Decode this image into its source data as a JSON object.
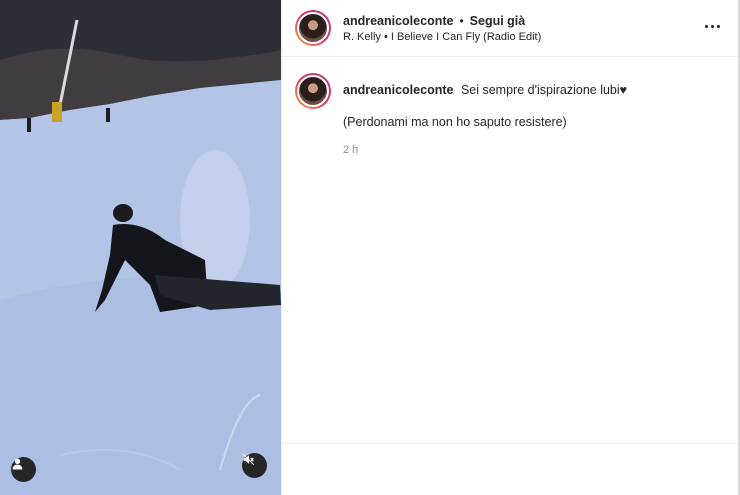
{
  "post": {
    "username": "andreanicoleconte",
    "follow_status": "Segui già",
    "separator": "•",
    "music": "R. Kelly • I Believe I Can Fly (Radio Edit)",
    "caption": {
      "username": "andreanicoleconte",
      "text": "Sei sempre d'ispirazione lubi♥",
      "second_line": "(Perdonami ma non ho saputo resistere)",
      "time": "2 h"
    }
  },
  "icons": {
    "more": "more-options-icon",
    "user_tag": "user-tag-icon",
    "mute": "speaker-muted-icon"
  },
  "colors": {
    "text": "#262626",
    "muted": "#8e8e8e",
    "story_ring": "#e1306c",
    "control_bg": "#262626"
  }
}
